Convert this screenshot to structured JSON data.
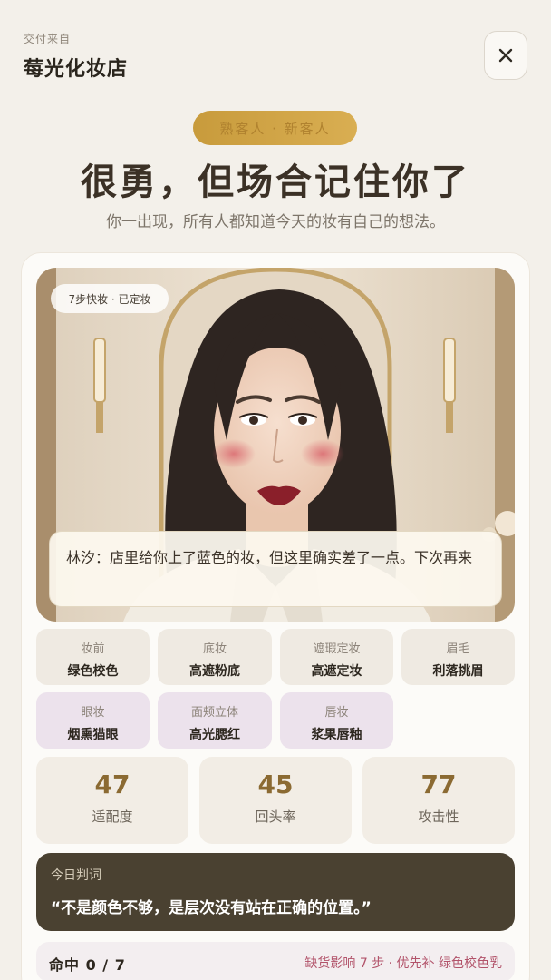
{
  "header": {
    "delivered_from": "交付来自",
    "store_name": "莓光化妆店"
  },
  "badge": {
    "label": "熟客人 · 新客人"
  },
  "headline": "很勇，但场合记住你了",
  "subline": "你一出现，所有人都知道今天的妆有自己的想法。",
  "photo": {
    "tag": "7步快妆 · 已定妆",
    "caption": "林汐：店里给你上了蓝色的妆，但这里确实差了一点。下次再来"
  },
  "steps": [
    {
      "label": "妆前",
      "value": "绿色校色"
    },
    {
      "label": "底妆",
      "value": "高遮粉底"
    },
    {
      "label": "遮瑕定妆",
      "value": "高遮定妆"
    },
    {
      "label": "眉毛",
      "value": "利落挑眉"
    },
    {
      "label": "眼妆",
      "value": "烟熏猫眼"
    },
    {
      "label": "面颊立体",
      "value": "高光腮红"
    },
    {
      "label": "唇妆",
      "value": "浆果唇釉"
    }
  ],
  "stats": [
    {
      "value": "47",
      "label": "适配度"
    },
    {
      "value": "45",
      "label": "回头率"
    },
    {
      "value": "77",
      "label": "攻击性"
    }
  ],
  "verdict": {
    "title": "今日判词",
    "quote": "“不是颜色不够，是层次没有站在正确的位置。”"
  },
  "hit": {
    "left": "命中 0 / 7",
    "right": "缺货影响 7 步 · 优先补 绿色校色乳"
  },
  "colors": {
    "accent_gold": "#c89b3c",
    "verdict_bg": "#4a4131",
    "warning_text": "#b2536a"
  },
  "icons": {
    "close": "close-icon"
  }
}
